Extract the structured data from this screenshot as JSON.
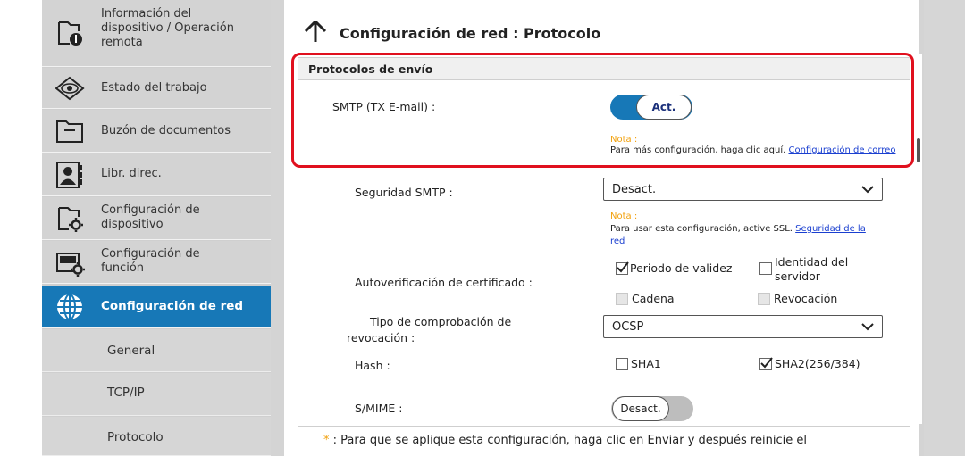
{
  "sidebar": {
    "items": [
      {
        "label_line1": "Información del",
        "label_line2": "dispositivo / Operación",
        "label_line3": "remota",
        "icon": "device-info-icon"
      },
      {
        "label": "Estado del trabajo",
        "icon": "eye-icon"
      },
      {
        "label": "Buzón de documentos",
        "icon": "folder-icon"
      },
      {
        "label": "Libr. direc.",
        "icon": "address-book-icon"
      },
      {
        "label_line1": "Configuración de",
        "label_line2": "dispositivo",
        "icon": "device-settings-icon"
      },
      {
        "label_line1": "Configuración de",
        "label_line2": "función",
        "icon": "function-settings-icon"
      },
      {
        "label": "Configuración de red",
        "icon": "globe-icon"
      }
    ],
    "subitems": [
      {
        "label": "General"
      },
      {
        "label": "TCP/IP"
      },
      {
        "label": "Protocolo"
      }
    ]
  },
  "page": {
    "title": "Configuración de red : Protocolo",
    "section": "Protocolos de envío"
  },
  "smtp": {
    "label": "SMTP (TX E-mail) :",
    "toggle": "Act.",
    "nota": "Nota :",
    "note_text": "Para más configuración, haga clic aquí.",
    "note_link": "Configuración de correo electrónico"
  },
  "smtp_security": {
    "label": "Seguridad SMTP :",
    "value": "Desact.",
    "nota": "Nota :",
    "note_text": "Para usar esta configuración, active SSL.",
    "note_link_1": "Seguridad de la",
    "note_link_2": "red"
  },
  "cert_check": {
    "label": "Autoverificación de certificado :",
    "options": [
      {
        "label": "Periodo de validez",
        "checked": true,
        "enabled": true
      },
      {
        "label_line1": "Identidad del",
        "label_line2": "servidor",
        "checked": false,
        "enabled": true
      },
      {
        "label": "Cadena",
        "checked": false,
        "enabled": false
      },
      {
        "label": "Revocación",
        "checked": false,
        "enabled": false
      }
    ]
  },
  "revocation": {
    "label_line1": "Tipo de comprobación de",
    "label_line2": "revocación :",
    "value": "OCSP"
  },
  "hash": {
    "label": "Hash :",
    "options": [
      {
        "label": "SHA1",
        "checked": false
      },
      {
        "label": "SHA2(256/384)",
        "checked": true
      }
    ]
  },
  "smime": {
    "label": "S/MIME :",
    "toggle": "Desact."
  },
  "footer": {
    "star": "*",
    "text": ":  Para que se aplique esta configuración, haga clic en Enviar y después reinicie el"
  },
  "colors": {
    "accent": "#1778b7",
    "highlight": "#e0101e",
    "nota": "#f2a10d",
    "link": "#1a3fd0"
  }
}
